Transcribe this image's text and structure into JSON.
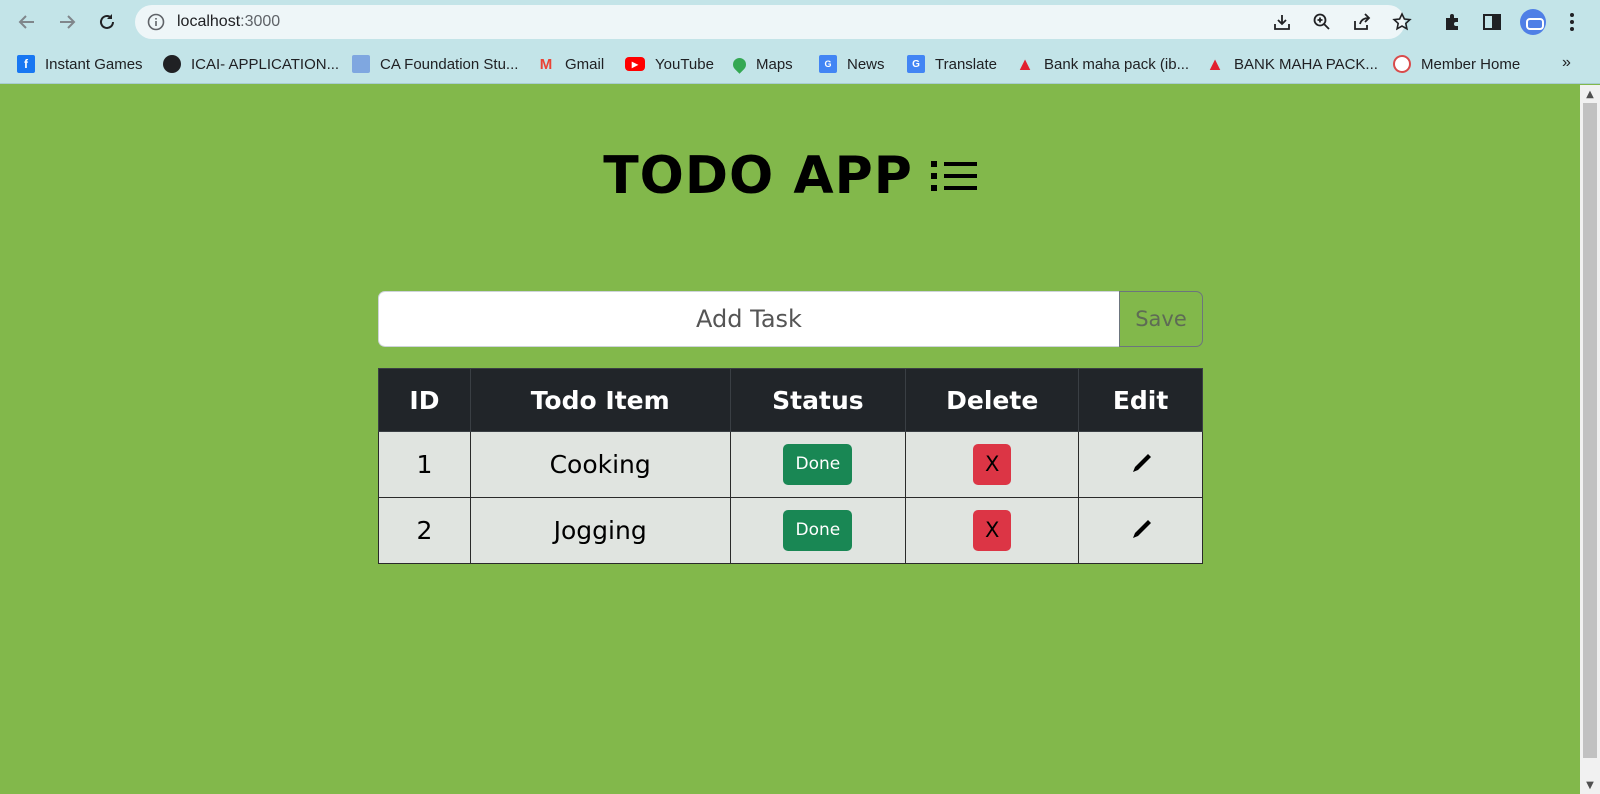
{
  "browser": {
    "url_host": "localhost",
    "url_port": ":3000",
    "bookmarks": [
      {
        "label": "Instant Games",
        "icon": "facebook-icon",
        "color": "#1877f2"
      },
      {
        "label": "ICAI- APPLICATION...",
        "icon": "globe-icon",
        "color": "#202124"
      },
      {
        "label": "CA Foundation Stu...",
        "icon": "ca-foundation-icon",
        "color": "#7fa7e0"
      },
      {
        "label": "Gmail",
        "icon": "gmail-icon",
        "color": "#ea4335"
      },
      {
        "label": "YouTube",
        "icon": "youtube-icon",
        "color": "#ff0000"
      },
      {
        "label": "Maps",
        "icon": "maps-icon",
        "color": "#34a853"
      },
      {
        "label": "News",
        "icon": "news-icon",
        "color": "#4285f4"
      },
      {
        "label": "Translate",
        "icon": "translate-icon",
        "color": "#4285f4"
      },
      {
        "label": "Bank maha pack (ib...",
        "icon": "bank-icon",
        "color": "#e2202f"
      },
      {
        "label": "BANK MAHA PACK...",
        "icon": "bank-icon",
        "color": "#e2202f"
      },
      {
        "label": "Member Home",
        "icon": "member-home-icon",
        "color": "#d94b4b"
      }
    ],
    "more_label": "»"
  },
  "app": {
    "title": "TODO APP",
    "input_placeholder": "Add Task",
    "save_label": "Save",
    "columns": [
      "ID",
      "Todo Item",
      "Status",
      "Delete",
      "Edit"
    ],
    "rows": [
      {
        "id": "1",
        "item": "Cooking",
        "status": "Done",
        "delete": "X"
      },
      {
        "id": "2",
        "item": "Jogging",
        "status": "Done",
        "delete": "X"
      }
    ]
  },
  "colors": {
    "page_background": "#82b84b",
    "header_background": "#212529",
    "done_button": "#198754",
    "delete_button": "#dc3545",
    "row_background": "#e0e4e0"
  }
}
